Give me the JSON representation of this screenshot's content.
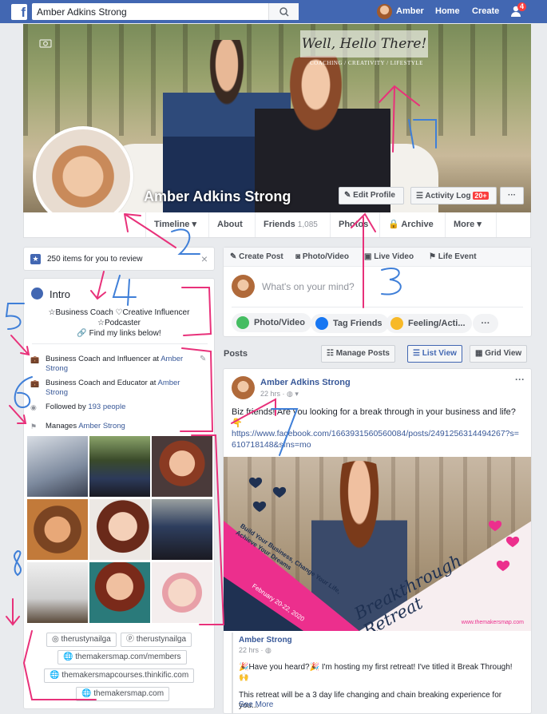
{
  "topbar": {
    "search_value": "Amber Adkins Strong",
    "user_name": "Amber",
    "home_label": "Home",
    "create_label": "Create",
    "notif_count": "4",
    "logo_letter": "f"
  },
  "cover": {
    "hello_text": "Well, Hello There!",
    "hello_sub": "COACHING / CREATIVITY / LIFESTYLE",
    "profile_name": "Amber Adkins Strong",
    "edit_profile": "Edit Profile",
    "activity_log": "Activity Log",
    "activity_badge": "20+",
    "more_dots": "···"
  },
  "tabs": {
    "timeline": "Timeline",
    "about": "About",
    "friends": "Friends",
    "friends_count": "1,085",
    "photos": "Photos",
    "archive": "Archive",
    "more": "More"
  },
  "review": {
    "text": "250 items for you to review",
    "close": "×"
  },
  "intro": {
    "title": "Intro",
    "bio_line1": "☆Business Coach ♡Creative Influencer",
    "bio_line2": "☆Podcaster",
    "bio_line3": "Find my links below!",
    "work1_prefix": "Business Coach and Influencer at ",
    "work1_link": "Amber Strong",
    "work2_prefix": "Business Coach and Educator at ",
    "work2_link": "Amber Strong",
    "followed_prefix": "Followed by ",
    "followed_link": "193 people",
    "manages_prefix": "Manages ",
    "manages_link": "Amber Strong",
    "links": [
      "therustynailga",
      "therustynailga",
      "themakersmap.com/members",
      "themakersmapcourses.thinkific.com",
      "themakersmap.com"
    ]
  },
  "composer": {
    "create_post": "Create Post",
    "photo_video_tab": "Photo/Video",
    "live_video": "Live Video",
    "life_event": "Life Event",
    "placeholder": "What's on your mind?",
    "photo_video_btn": "Photo/Video",
    "tag_friends": "Tag Friends",
    "feeling": "Feeling/Acti...",
    "more": "···"
  },
  "posts_bar": {
    "label": "Posts",
    "manage": "Manage Posts",
    "list_view": "List View",
    "grid_view": "Grid View"
  },
  "post": {
    "author": "Amber Adkins Strong",
    "time": "22 hrs · ",
    "menu": "···",
    "text": "Biz friends! Are you looking for a break through in your business and life? 👇",
    "url": "https://www.facebook.com/1663931560560084/posts/2491256314494267?s=610718148&sfns=mo",
    "banner_title": "Breakthrough Retreat",
    "banner_sub": "Build Your Business, Change Your Life, Achieve Your Dreams",
    "banner_date": "February 20-22, 2020",
    "banner_url": "www.themakersmap.com",
    "shared_author": "Amber Strong",
    "shared_time": "22 hrs · ",
    "shared_text1": "🎉Have you heard?🎉 I'm hosting my first retreat! I've titled it Break Through! 🙌",
    "shared_text2": "This retreat will be a 3 day life changing and chain breaking experience for you...",
    "see_more": "See More"
  },
  "annotations": [
    "1",
    "2",
    "3",
    "4",
    "5",
    "6",
    "7",
    "8"
  ],
  "colors": {
    "fb_blue": "#4267b2",
    "link": "#385898",
    "annotation": "#e8317a",
    "annotation_blue": "#3f7fd8"
  }
}
